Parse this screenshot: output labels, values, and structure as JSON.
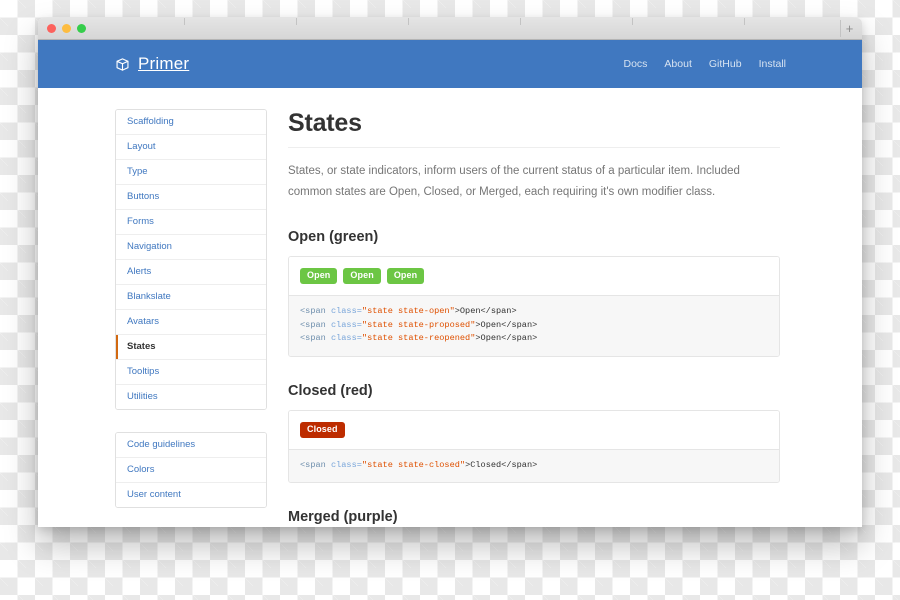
{
  "browser": {
    "traffic_lights": [
      "close",
      "minimize",
      "zoom"
    ],
    "new_tab_label": "+"
  },
  "masthead": {
    "brand_name": "Primer",
    "brand_icon": "package-box-icon",
    "accent_color": "#4078c0",
    "nav": [
      {
        "label": "Docs"
      },
      {
        "label": "About"
      },
      {
        "label": "GitHub"
      },
      {
        "label": "Install"
      }
    ]
  },
  "sidebar": {
    "groups": [
      {
        "items": [
          {
            "label": "Scaffolding",
            "active": false
          },
          {
            "label": "Layout",
            "active": false
          },
          {
            "label": "Type",
            "active": false
          },
          {
            "label": "Buttons",
            "active": false
          },
          {
            "label": "Forms",
            "active": false
          },
          {
            "label": "Navigation",
            "active": false
          },
          {
            "label": "Alerts",
            "active": false
          },
          {
            "label": "Blankslate",
            "active": false
          },
          {
            "label": "Avatars",
            "active": false
          },
          {
            "label": "States",
            "active": true
          },
          {
            "label": "Tooltips",
            "active": false
          },
          {
            "label": "Utilities",
            "active": false
          }
        ]
      },
      {
        "items": [
          {
            "label": "Code guidelines",
            "active": false
          },
          {
            "label": "Colors",
            "active": false
          },
          {
            "label": "User content",
            "active": false
          }
        ]
      }
    ],
    "active_indicator_color": "#d26911",
    "link_color": "#4078c0"
  },
  "main": {
    "title": "States",
    "lead": "States, or state indicators, inform users of the current status of a particular item. Included common states are Open, Closed, or Merged, each requiring it's own modifier class.",
    "sections": [
      {
        "heading": "Open (green)",
        "badges": [
          {
            "label": "Open",
            "modifier": "state-open",
            "color": "#6cc644"
          },
          {
            "label": "Open",
            "modifier": "state-proposed",
            "color": "#6cc644"
          },
          {
            "label": "Open",
            "modifier": "state-reopened",
            "color": "#6cc644"
          }
        ],
        "code_lines": [
          {
            "open": "<span ",
            "attr": "class=",
            "string": "\"state state-open\"",
            "close": ">Open</span>"
          },
          {
            "open": "<span ",
            "attr": "class=",
            "string": "\"state state-proposed\"",
            "close": ">Open</span>"
          },
          {
            "open": "<span ",
            "attr": "class=",
            "string": "\"state state-reopened\"",
            "close": ">Open</span>"
          }
        ]
      },
      {
        "heading": "Closed (red)",
        "badges": [
          {
            "label": "Closed",
            "modifier": "state-closed",
            "color": "#bd2c00"
          }
        ],
        "code_lines": [
          {
            "open": "<span ",
            "attr": "class=",
            "string": "\"state state-closed\"",
            "close": ">Closed</span>"
          }
        ]
      },
      {
        "heading": "Merged (purple)",
        "badges": [],
        "code_lines": []
      }
    ]
  }
}
